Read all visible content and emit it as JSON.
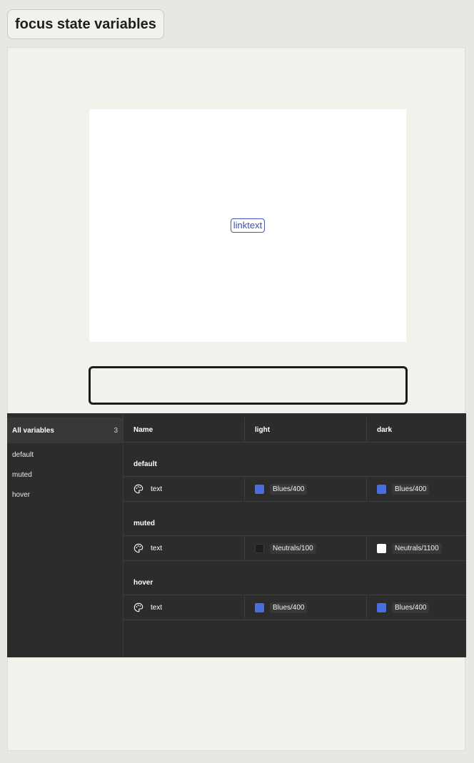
{
  "header": {
    "title": "focus state variables"
  },
  "preview": {
    "link_text": "linktext"
  },
  "variables_panel": {
    "sidebar": {
      "all_label": "All variables",
      "count": "3",
      "groups": [
        "default",
        "muted",
        "hover"
      ]
    },
    "columns": [
      "Name",
      "light",
      "dark"
    ],
    "groups": [
      {
        "name": "default",
        "rows": [
          {
            "name": "text",
            "light": {
              "label": "Blues/400",
              "color": "#4a6ee0"
            },
            "dark": {
              "label": "Blues/400",
              "color": "#4a6ee0"
            }
          }
        ]
      },
      {
        "name": "muted",
        "rows": [
          {
            "name": "text",
            "light": {
              "label": "Neutrals/100",
              "color": "#1e1e1e"
            },
            "dark": {
              "label": "Neutrals/1100",
              "color": "#ffffff"
            }
          }
        ]
      },
      {
        "name": "hover",
        "rows": [
          {
            "name": "text",
            "light": {
              "label": "Blues/400",
              "color": "#4a6ee0"
            },
            "dark": {
              "label": "Blues/400",
              "color": "#4a6ee0"
            }
          }
        ]
      }
    ],
    "icons": {
      "variable_type": "palette-icon"
    }
  }
}
